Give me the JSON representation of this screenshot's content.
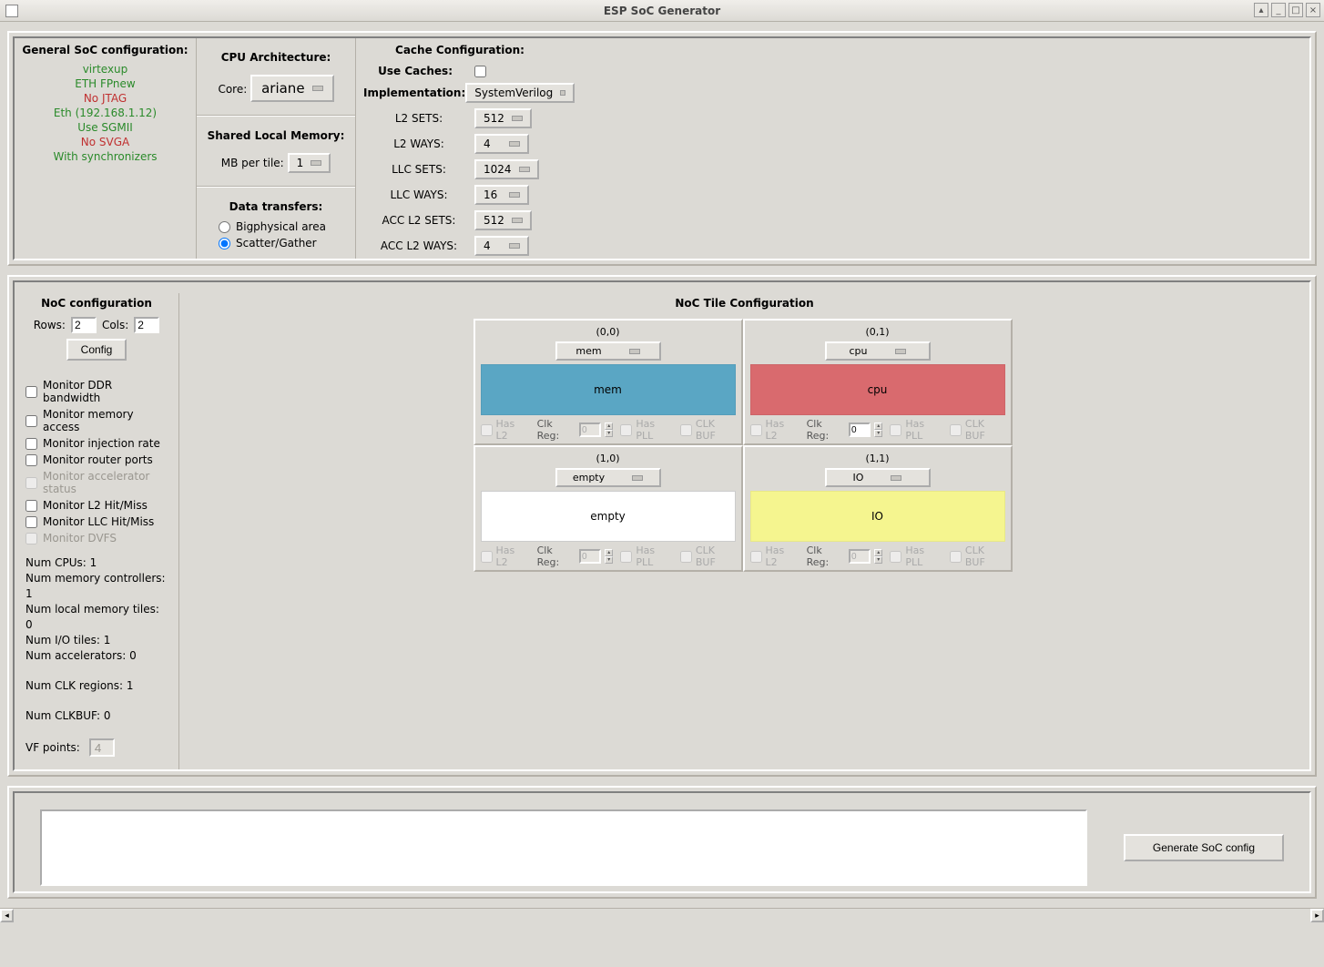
{
  "window": {
    "title": "ESP SoC Generator"
  },
  "general": {
    "title": "General SoC configuration:",
    "items": [
      {
        "text": "virtexup",
        "cls": "green"
      },
      {
        "text": "ETH FPnew",
        "cls": "green"
      },
      {
        "text": "No JTAG",
        "cls": "red"
      },
      {
        "text": "Eth (192.168.1.12)",
        "cls": "green"
      },
      {
        "text": "Use SGMII",
        "cls": "green"
      },
      {
        "text": "No SVGA",
        "cls": "red"
      },
      {
        "text": "With synchronizers",
        "cls": "green"
      }
    ]
  },
  "cpu": {
    "title": "CPU Architecture:",
    "core_label": "Core:",
    "core_value": "ariane",
    "shared_title": "Shared Local Memory:",
    "mb_label": "MB per tile:",
    "mb_value": "1",
    "dt_title": "Data transfers:",
    "radio_big": "Bigphysical area",
    "radio_sg": "Scatter/Gather"
  },
  "cache": {
    "title": "Cache Configuration:",
    "use_label": "Use Caches:",
    "impl_label": "Implementation:",
    "impl_value": "SystemVerilog",
    "rows": [
      {
        "label": "L2 SETS:",
        "value": "512"
      },
      {
        "label": "L2 WAYS:",
        "value": "4"
      },
      {
        "label": "LLC SETS:",
        "value": "1024"
      },
      {
        "label": "LLC WAYS:",
        "value": "16"
      },
      {
        "label": "ACC L2 SETS:",
        "value": "512"
      },
      {
        "label": "ACC L2 WAYS:",
        "value": "4"
      }
    ]
  },
  "noc": {
    "title": "NoC configuration",
    "rows_label": "Rows:",
    "rows_val": "2",
    "cols_label": "Cols:",
    "cols_val": "2",
    "config_btn": "Config",
    "checks": [
      {
        "label": "Monitor DDR bandwidth",
        "dis": false
      },
      {
        "label": "Monitor memory access",
        "dis": false
      },
      {
        "label": "Monitor injection rate",
        "dis": false
      },
      {
        "label": "Monitor router ports",
        "dis": false
      },
      {
        "label": "Monitor accelerator status",
        "dis": true
      },
      {
        "label": "Monitor L2 Hit/Miss",
        "dis": false
      },
      {
        "label": "Monitor LLC Hit/Miss",
        "dis": false
      },
      {
        "label": "Monitor DVFS",
        "dis": true
      }
    ],
    "stats": [
      "Num CPUs: 1",
      "Num memory controllers: 1",
      "Num local memory tiles: 0",
      "Num I/O tiles: 1",
      "Num accelerators: 0"
    ],
    "clk_regions": "Num CLK regions: 1",
    "clkbuf": "Num CLKBUF: 0",
    "vf_label": "VF points:",
    "vf_value": "4"
  },
  "tiles": {
    "title": "NoC Tile Configuration",
    "foot": {
      "hasl2": "Has L2",
      "clkreg": "Clk Reg:",
      "haspll": "Has PLL",
      "clkbuf": "CLK BUF"
    },
    "list": [
      {
        "coord": "(0,0)",
        "sel": "mem",
        "body": "mem",
        "cls": "mem",
        "clk": "0",
        "clk_dis": true
      },
      {
        "coord": "(0,1)",
        "sel": "cpu",
        "body": "cpu",
        "cls": "cpu",
        "clk": "0",
        "clk_dis": false
      },
      {
        "coord": "(1,0)",
        "sel": "empty",
        "body": "empty",
        "cls": "empty",
        "clk": "0",
        "clk_dis": true
      },
      {
        "coord": "(1,1)",
        "sel": "IO",
        "body": "IO",
        "cls": "io",
        "clk": "0",
        "clk_dis": true
      }
    ]
  },
  "bottom": {
    "generate": "Generate SoC config"
  }
}
